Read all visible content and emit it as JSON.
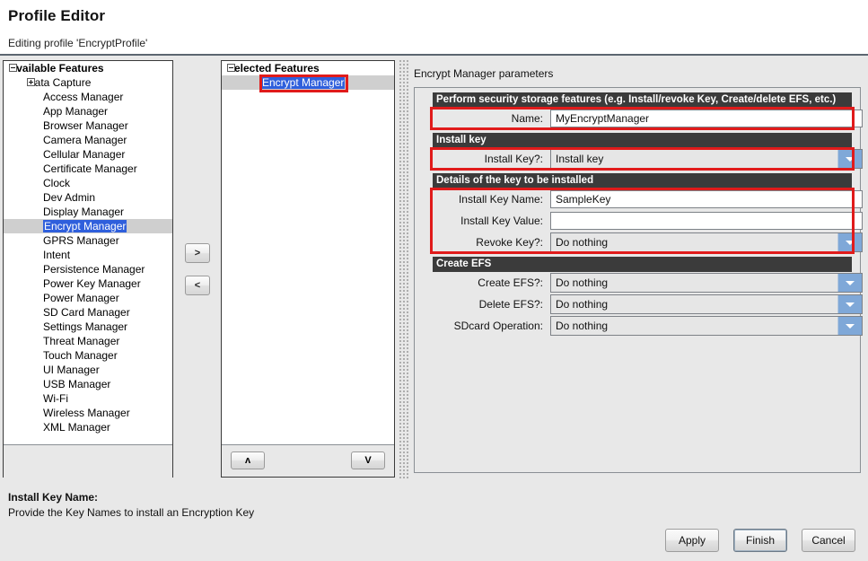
{
  "window": {
    "title": "Profile Editor",
    "subtitle": "Editing profile 'EncryptProfile'"
  },
  "available_features": {
    "header": "Available Features",
    "items": [
      {
        "label": "Data Capture",
        "level": 1,
        "twisty": "plus"
      },
      {
        "label": "Access Manager",
        "level": 2
      },
      {
        "label": "App Manager",
        "level": 2
      },
      {
        "label": "Browser Manager",
        "level": 2
      },
      {
        "label": "Camera Manager",
        "level": 2
      },
      {
        "label": "Cellular Manager",
        "level": 2
      },
      {
        "label": "Certificate Manager",
        "level": 2
      },
      {
        "label": "Clock",
        "level": 2
      },
      {
        "label": "Dev Admin",
        "level": 2
      },
      {
        "label": "Display Manager",
        "level": 2
      },
      {
        "label": "Encrypt Manager",
        "level": 2,
        "selected": true
      },
      {
        "label": "GPRS Manager",
        "level": 2
      },
      {
        "label": "Intent",
        "level": 2
      },
      {
        "label": "Persistence Manager",
        "level": 2
      },
      {
        "label": "Power Key Manager",
        "level": 2
      },
      {
        "label": "Power Manager",
        "level": 2
      },
      {
        "label": "SD Card Manager",
        "level": 2
      },
      {
        "label": "Settings Manager",
        "level": 2
      },
      {
        "label": "Threat Manager",
        "level": 2
      },
      {
        "label": "Touch Manager",
        "level": 2
      },
      {
        "label": "UI Manager",
        "level": 2
      },
      {
        "label": "USB Manager",
        "level": 2
      },
      {
        "label": "Wi-Fi",
        "level": 2
      },
      {
        "label": "Wireless Manager",
        "level": 2
      },
      {
        "label": "XML Manager",
        "level": 2
      }
    ]
  },
  "transfer": {
    "add_label": ">",
    "remove_label": "<"
  },
  "selected_features": {
    "header": "Selected Features",
    "items": [
      {
        "label": "Encrypt Manager",
        "level": 2,
        "selected": true
      }
    ],
    "move_up_label": "ʌ",
    "move_down_label": "V"
  },
  "parameters": {
    "heading": "Encrypt Manager parameters",
    "sections": [
      {
        "title": "Perform security storage features (e.g. Install/revoke Key, Create/delete EFS, etc.)",
        "fields": [
          {
            "label": "Name:",
            "type": "text",
            "value": "MyEncryptManager"
          }
        ]
      },
      {
        "title": "Install key",
        "fields": [
          {
            "label": "Install Key?:",
            "type": "combo",
            "value": "Install key"
          }
        ]
      },
      {
        "title": "Details of the key to be installed",
        "fields": [
          {
            "label": "Install Key Name:",
            "type": "text",
            "value": "SampleKey"
          },
          {
            "label": "Install Key Value:",
            "type": "text",
            "value": ""
          },
          {
            "label": "Revoke Key?:",
            "type": "combo",
            "value": "Do nothing"
          }
        ]
      },
      {
        "title": "Create EFS",
        "fields": [
          {
            "label": "Create EFS?:",
            "type": "combo",
            "value": "Do nothing"
          },
          {
            "label": "Delete EFS?:",
            "type": "combo",
            "value": "Do nothing"
          },
          {
            "label": "SDcard Operation:",
            "type": "combo",
            "value": "Do nothing"
          }
        ]
      }
    ]
  },
  "status": {
    "title": "Install Key Name:",
    "description": "Provide the Key Names to install an Encryption Key"
  },
  "footer": {
    "apply_label": "Apply",
    "finish_label": "Finish",
    "cancel_label": "Cancel"
  },
  "colors": {
    "annotation": "#e01b1b",
    "section_header_bg": "#3b3b3b",
    "selection_blue": "#2f5fdc",
    "combo_arrow": "#7fa8d8"
  }
}
